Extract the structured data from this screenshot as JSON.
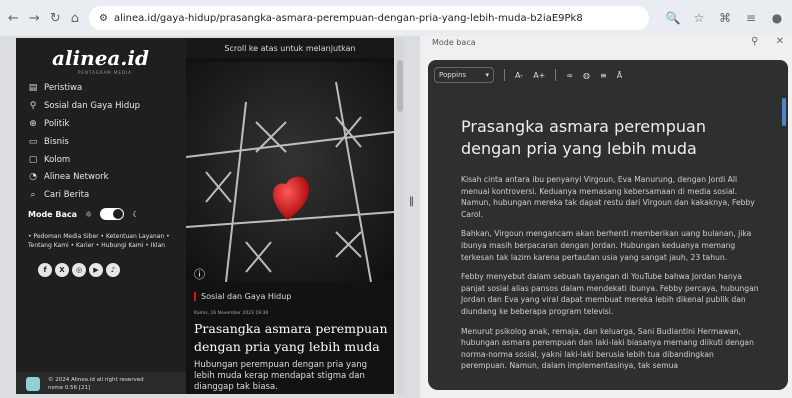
{
  "browser": {
    "url": "alinea.id/gaya-hidup/prasangka-asmara-perempuan-dengan-pria-yang-lebih-muda-b2iaE9Pk8"
  },
  "site": {
    "brand": "alinea.id",
    "brand_sub": "PENTAGRAM MEDIA",
    "nav": [
      {
        "label": "Peristiwa",
        "icon": "newspaper-icon"
      },
      {
        "label": "Sosial dan Gaya Hidup",
        "icon": "lifestyle-icon"
      },
      {
        "label": "Politik",
        "icon": "globe-icon"
      },
      {
        "label": "Bisnis",
        "icon": "briefcase-icon"
      },
      {
        "label": "Kolom",
        "icon": "column-icon"
      },
      {
        "label": "Alinea Network",
        "icon": "network-icon"
      },
      {
        "label": "Cari Berita",
        "icon": "search-icon"
      }
    ],
    "mode_label": "Mode Baca",
    "footer_links": "• Pedoman Media Siber • Ketentuan Layanan • Tentang Kami • Karier • Hubungi Kami • Iklan",
    "copyright": "© 2024 Alinea.id all right reserved",
    "version": "nsme 0.56 [21]"
  },
  "article": {
    "scroll_note": "Scroll ke atas untuk melanjutkan",
    "category": "Sosial dan Gaya Hidup",
    "date": "Kamis, 16 November 2023 19:30",
    "title": "Prasangka asmara perempuan dengan pria yang lebih muda",
    "lede": "Hubungan perempuan dengan pria yang lebih muda kerap mendapat stigma dan dianggap tak biasa."
  },
  "reader": {
    "header": "Mode baca",
    "font": "Poppins",
    "tools": [
      "A-",
      "A+"
    ],
    "title": "Prasangka asmara perempuan dengan pria yang lebih muda",
    "paragraphs": [
      "Kisah cinta antara ibu penyanyi Virgoun, Eva Manurung, dengan Jordi Ali menuai kontroversi. Keduanya memasang kebersamaan di media sosial. Namun, hubungan mereka tak dapat restu dari Virgoun dan kakaknya, Febby Carol.",
      "Bahkan, Virgoun mengancam akan berhenti memberikan uang bulanan, jika ibunya masih berpacaran dengan Jordan. Hubungan keduanya memang terkesan tak lazim karena pertautan usia yang sangat jauh, 23 tahun.",
      "Febby menyebut dalam sebuah tayangan di YouTube bahwa Jordan hanya panjat sosial alias pansos dalam mendekati ibunya. Febby percaya, hubungan Jordan dan Eva yang viral dapat membuat mereka lebih dikenal publik dan diundang ke beberapa program televisi.",
      "Menurut psikolog anak, remaja, dan keluarga, Sani Budiantini Hermawan, hubungan asmara perempuan dan laki-laki biasanya memang diikuti dengan norma-norma sosial, yakni laki-laki berusia lebih tua dibandingkan perempuan. Namun, dalam implementasinya, tak semua"
    ]
  }
}
